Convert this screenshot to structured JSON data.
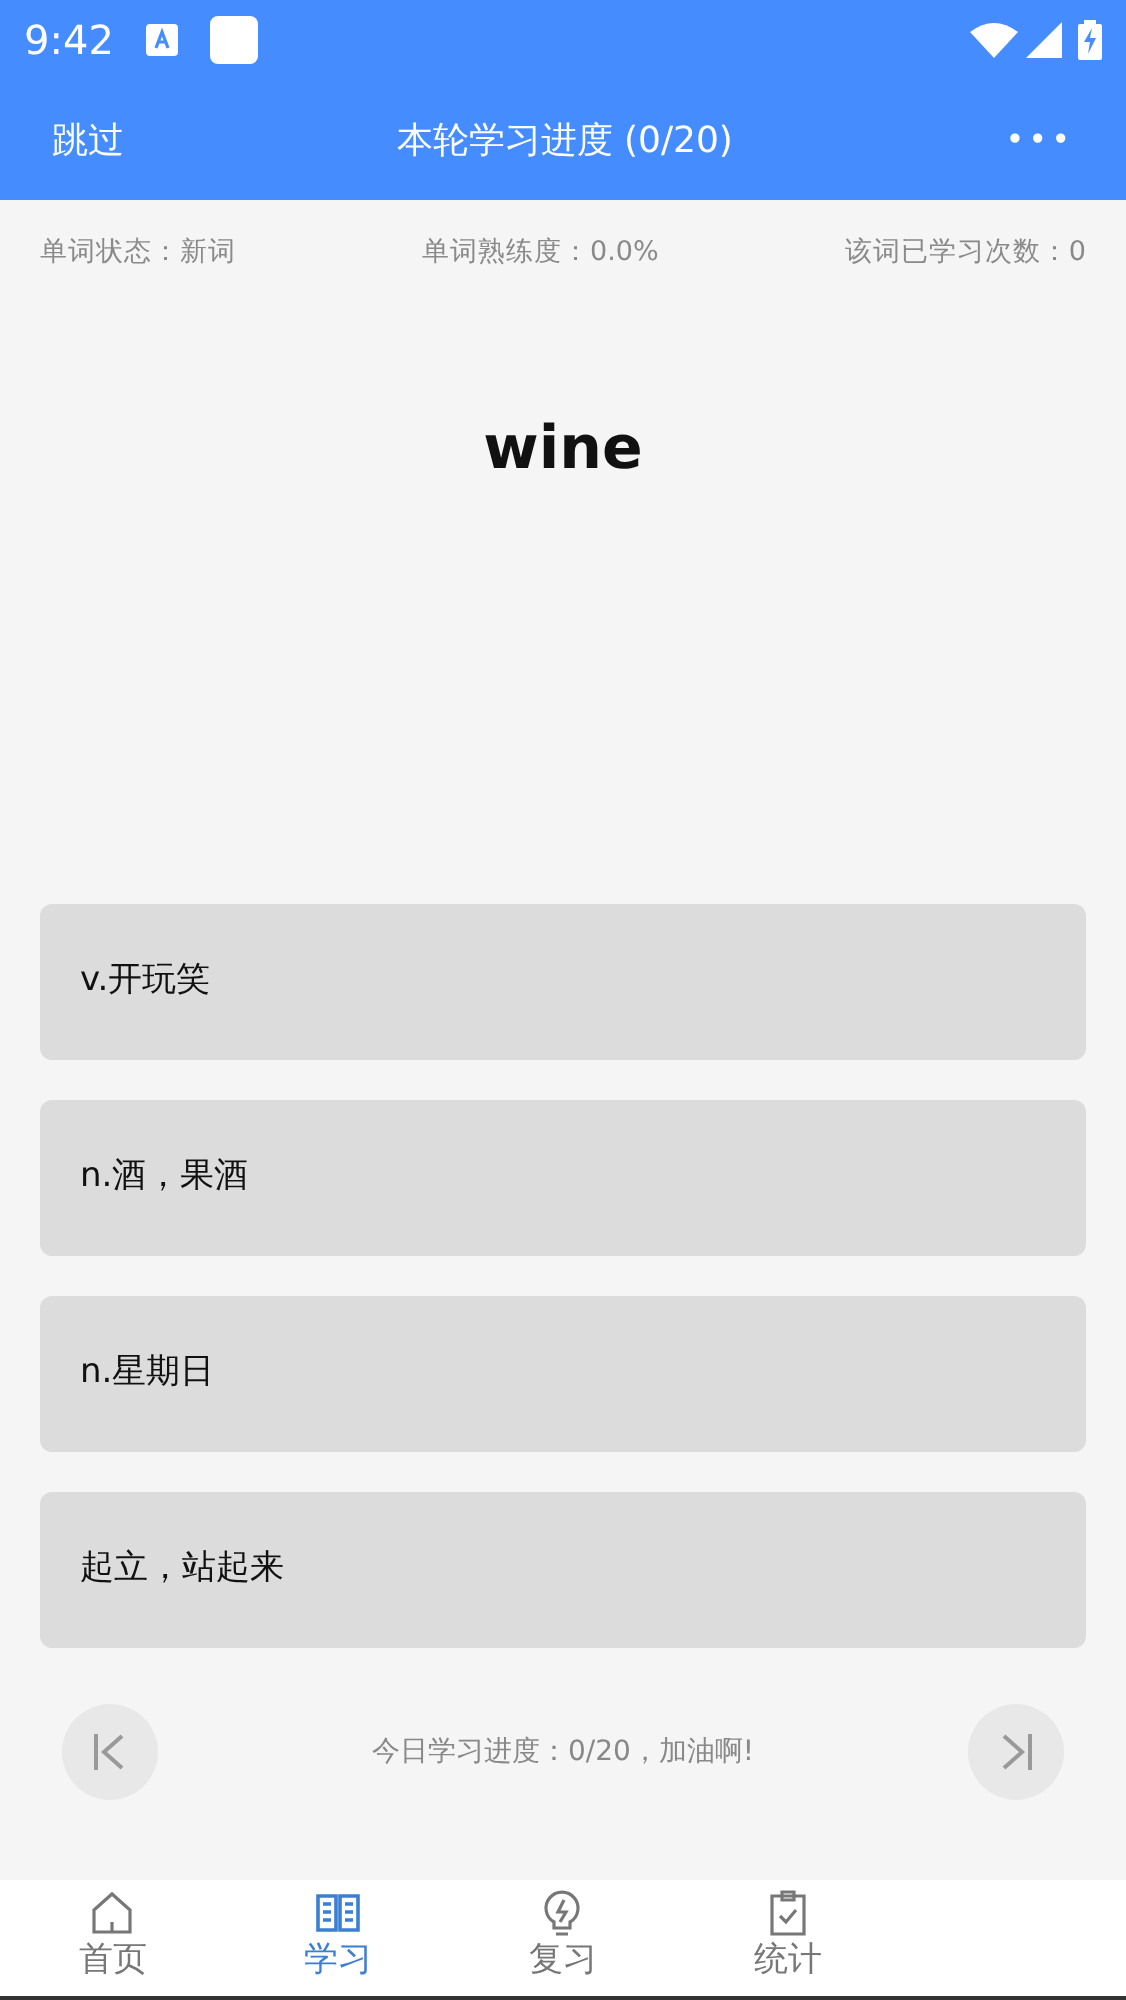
{
  "status_bar": {
    "time": "9:42"
  },
  "header": {
    "left": "跳过",
    "title": "本轮学习进度 (0/20)",
    "menu": "•••"
  },
  "info": [
    {
      "text": "单词状态：新词"
    },
    {
      "text": "单词熟练度：0.0%"
    },
    {
      "text": "该词已学习次数：0"
    }
  ],
  "word": "wine",
  "options": [
    {
      "text": "v.开玩笑"
    },
    {
      "text": "n.酒，果酒"
    },
    {
      "text": "n.星期日"
    },
    {
      "text": "起立，站起来"
    }
  ],
  "progress_text": "今日学习进度：0/20，加油啊!",
  "tabs": [
    {
      "label": "首页",
      "selected": false
    },
    {
      "label": "学习",
      "selected": true
    },
    {
      "label": "复习",
      "selected": false
    },
    {
      "label": "统计",
      "selected": false
    }
  ]
}
